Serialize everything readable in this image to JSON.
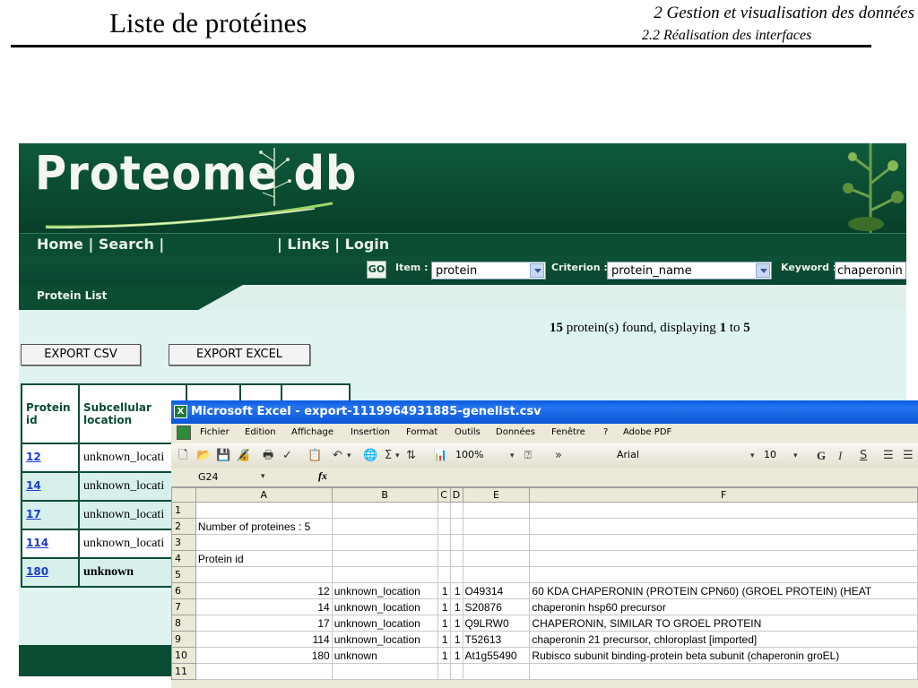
{
  "slide": {
    "title": "Liste de protéines",
    "chapter": "2 Gestion et visualisation des données",
    "section": "2.2 Réalisation des interfaces"
  },
  "app": {
    "logo": "Proteome db",
    "nav_left": "Home | Search |",
    "nav_right": "| Links | Login",
    "search": {
      "go": "GO",
      "item_label": "Item :",
      "item_value": "protein",
      "criterion_label": "Criterion :",
      "criterion_value": "protein_name",
      "keyword_label": "Keyword :",
      "keyword_value": "chaperonin"
    },
    "tab_label": "Protein List",
    "found": {
      "count": "15",
      "text_mid": " protein(s) found, displaying ",
      "from": "1",
      "to_word": " to ",
      "to": "5"
    },
    "buttons": {
      "export_csv": "EXPORT CSV",
      "export_excel": "EXPORT EXCEL"
    },
    "table": {
      "headers": [
        "Protein id",
        "Subcellular location"
      ],
      "rows": [
        {
          "id": "12",
          "location": "unknown_locati"
        },
        {
          "id": "14",
          "location": "unknown_locati"
        },
        {
          "id": "17",
          "location": "unknown_locati"
        },
        {
          "id": "114",
          "location": "unknown_locati"
        },
        {
          "id": "180",
          "location": "unknown"
        }
      ]
    }
  },
  "excel": {
    "title": "Microsoft Excel - export-1119964931885-genelist.csv",
    "menu": [
      "Fichier",
      "Edition",
      "Affichage",
      "Insertion",
      "Format",
      "Outils",
      "Données",
      "Fenêtre",
      "?",
      "Adobe PDF"
    ],
    "zoom": "100%",
    "font": "Arial",
    "font_size": "10",
    "name_box": "G24",
    "fx": "fx",
    "columns": [
      "A",
      "B",
      "C",
      "D",
      "E",
      "F"
    ],
    "rows": [
      {
        "n": "1",
        "a": "",
        "b": "",
        "c": "",
        "d": "",
        "e": "",
        "f": ""
      },
      {
        "n": "2",
        "a": "Number of proteines : 5",
        "b": "",
        "c": "",
        "d": "",
        "e": "",
        "f": ""
      },
      {
        "n": "3",
        "a": "",
        "b": "",
        "c": "",
        "d": "",
        "e": "",
        "f": ""
      },
      {
        "n": "4",
        "a": "Protein id",
        "b": "",
        "c": "",
        "d": "",
        "e": "",
        "f": ""
      },
      {
        "n": "5",
        "a": "",
        "b": "",
        "c": "",
        "d": "",
        "e": "",
        "f": ""
      },
      {
        "n": "6",
        "a": "12",
        "b": "unknown_location",
        "c": "1",
        "d": "1",
        "e": "O49314",
        "f": "60 KDA CHAPERONIN (PROTEIN CPN60) (GROEL PROTEIN) (HEAT"
      },
      {
        "n": "7",
        "a": "14",
        "b": "unknown_location",
        "c": "1",
        "d": "1",
        "e": "S20876",
        "f": "chaperonin hsp60 precursor"
      },
      {
        "n": "8",
        "a": "17",
        "b": "unknown_location",
        "c": "1",
        "d": "1",
        "e": "Q9LRW0",
        "f": "CHAPERONIN, SIMILAR TO GROEL PROTEIN"
      },
      {
        "n": "9",
        "a": "114",
        "b": "unknown_location",
        "c": "1",
        "d": "1",
        "e": "T52613",
        "f": "chaperonin 21 precursor, chloroplast [imported]"
      },
      {
        "n": "10",
        "a": "180",
        "b": "unknown",
        "c": "1",
        "d": "1",
        "e": "At1g55490",
        "f": "Rubisco subunit binding-protein beta subunit (chaperonin groEL)"
      },
      {
        "n": "11",
        "a": "",
        "b": "",
        "c": "",
        "d": "",
        "e": "",
        "f": ""
      }
    ]
  },
  "colors": {
    "brand_green": "#0b4d33",
    "link_blue": "#1a3ec8",
    "xp_title_blue": "#0a5ce0"
  }
}
